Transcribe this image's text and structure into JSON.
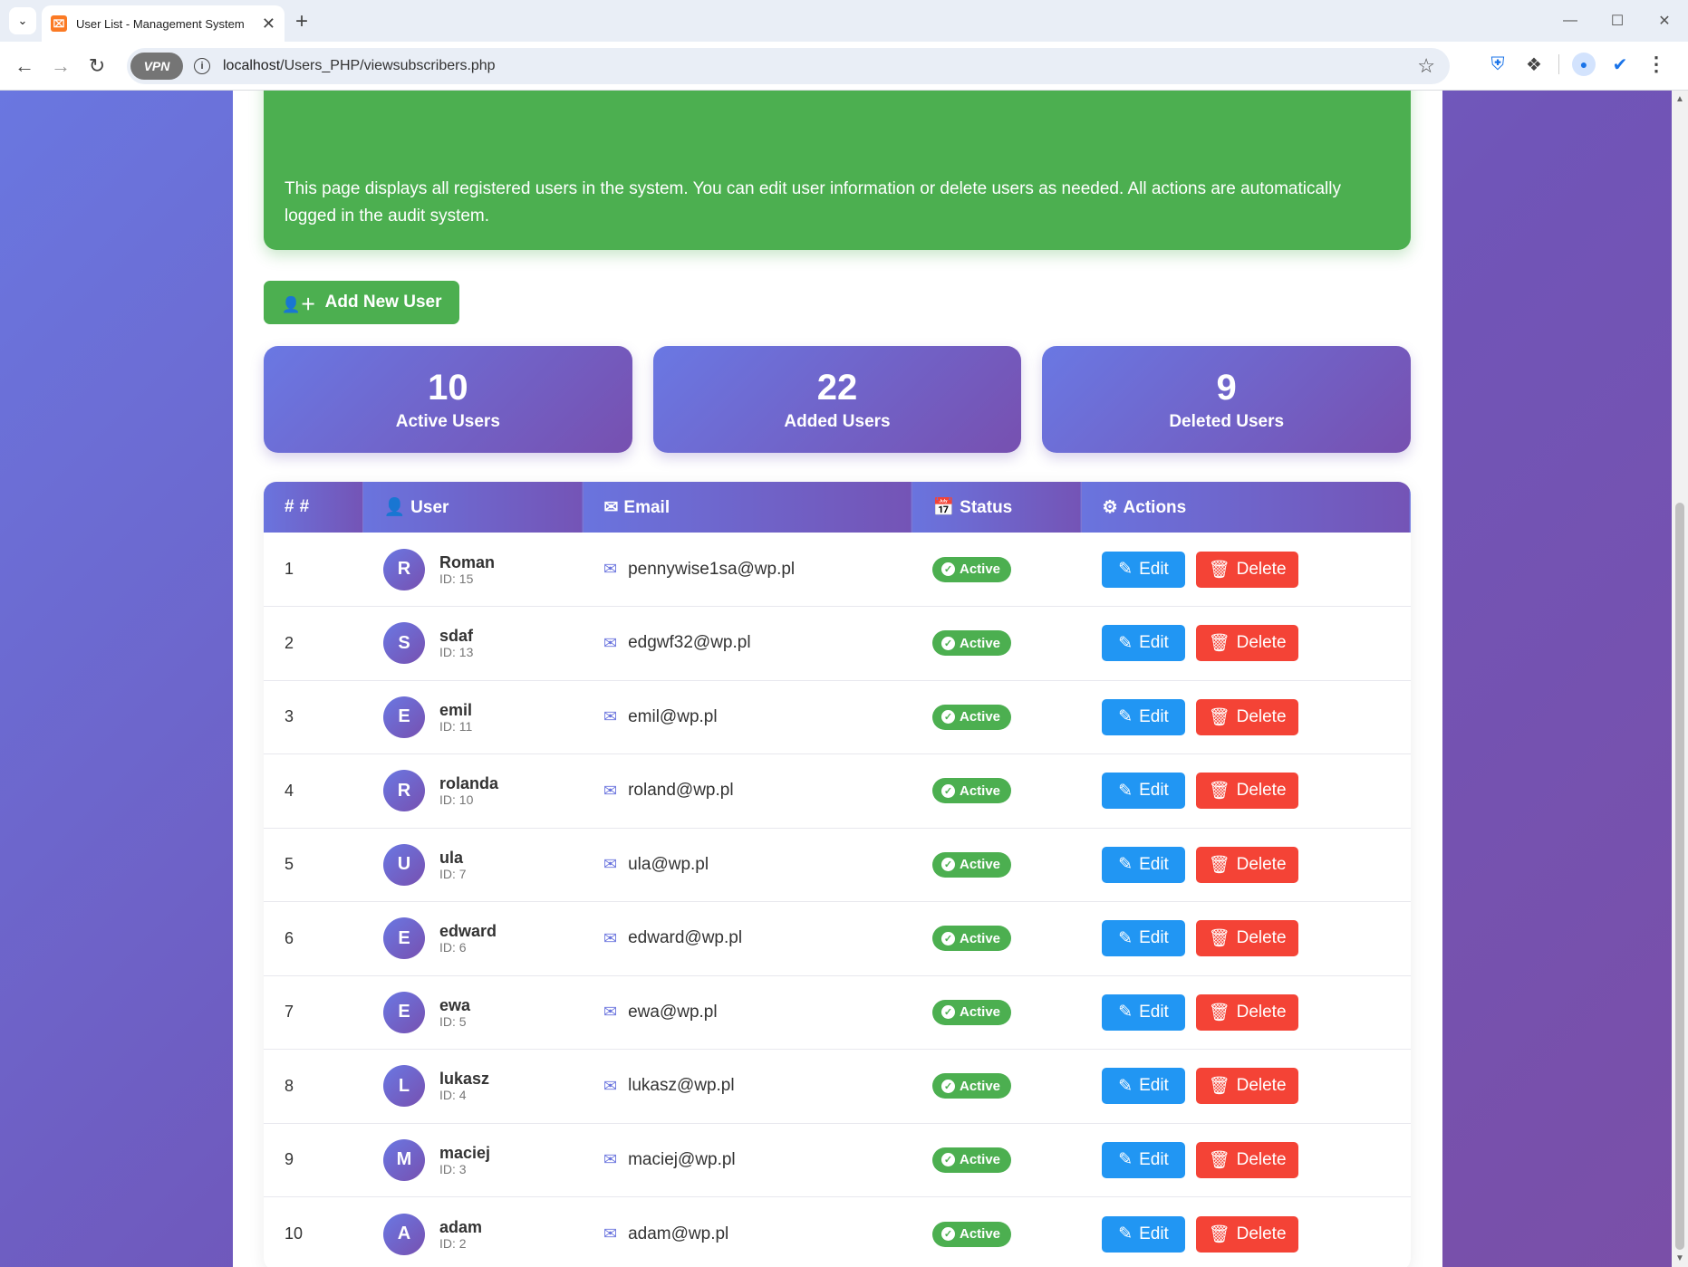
{
  "browser": {
    "tab_title": "User List - Management System",
    "url_host": "localhost",
    "url_path": "/Users_PHP/viewsubscribers.php",
    "vpn_label": "VPN"
  },
  "page": {
    "info_text": "This page displays all registered users in the system. You can edit user information or delete users as needed. All actions are automatically logged in the audit system.",
    "add_button_label": "Add New User",
    "stats": [
      {
        "value": "10",
        "label": "Active Users"
      },
      {
        "value": "22",
        "label": "Added Users"
      },
      {
        "value": "9",
        "label": "Deleted Users"
      }
    ],
    "table": {
      "headers": {
        "num": "#",
        "user": "User",
        "email": "Email",
        "status": "Status",
        "actions": "Actions"
      },
      "edit_label": "Edit",
      "delete_label": "Delete",
      "rows": [
        {
          "num": "1",
          "initial": "R",
          "name": "Roman",
          "id": "ID: 15",
          "email": "pennywise1sa@wp.pl",
          "status": "Active"
        },
        {
          "num": "2",
          "initial": "S",
          "name": "sdaf",
          "id": "ID: 13",
          "email": "edgwf32@wp.pl",
          "status": "Active"
        },
        {
          "num": "3",
          "initial": "E",
          "name": "emil",
          "id": "ID: 11",
          "email": "emil@wp.pl",
          "status": "Active"
        },
        {
          "num": "4",
          "initial": "R",
          "name": "rolanda",
          "id": "ID: 10",
          "email": "roland@wp.pl",
          "status": "Active"
        },
        {
          "num": "5",
          "initial": "U",
          "name": "ula",
          "id": "ID: 7",
          "email": "ula@wp.pl",
          "status": "Active"
        },
        {
          "num": "6",
          "initial": "E",
          "name": "edward",
          "id": "ID: 6",
          "email": "edward@wp.pl",
          "status": "Active"
        },
        {
          "num": "7",
          "initial": "E",
          "name": "ewa",
          "id": "ID: 5",
          "email": "ewa@wp.pl",
          "status": "Active"
        },
        {
          "num": "8",
          "initial": "L",
          "name": "lukasz",
          "id": "ID: 4",
          "email": "lukasz@wp.pl",
          "status": "Active"
        },
        {
          "num": "9",
          "initial": "M",
          "name": "maciej",
          "id": "ID: 3",
          "email": "maciej@wp.pl",
          "status": "Active"
        },
        {
          "num": "10",
          "initial": "A",
          "name": "adam",
          "id": "ID: 2",
          "email": "adam@wp.pl",
          "status": "Active"
        }
      ]
    }
  },
  "colors": {
    "success": "#4caf50",
    "primary_gradient_start": "#6a78e3",
    "primary_gradient_end": "#7750b0",
    "edit": "#2196f3",
    "delete": "#f44336"
  }
}
